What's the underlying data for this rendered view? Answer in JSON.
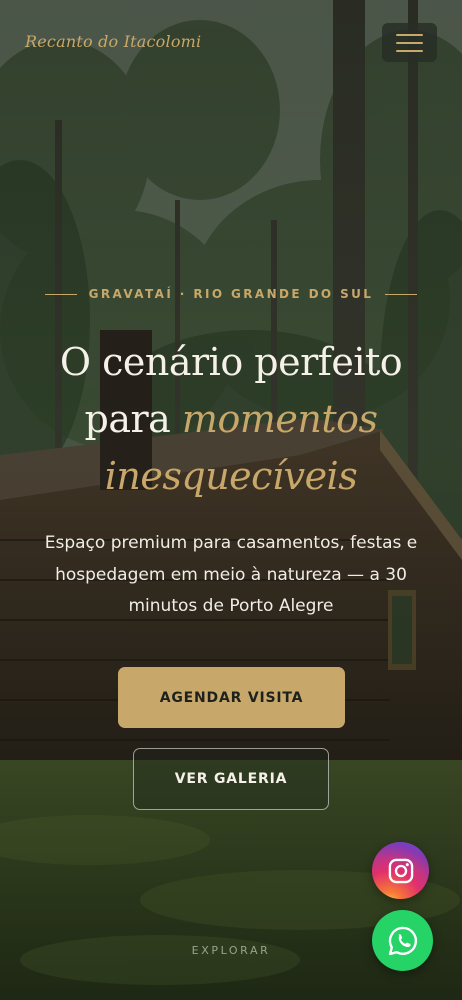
{
  "header": {
    "brand": "Recanto do Itacolomi",
    "menu_icon": "hamburger-icon"
  },
  "hero": {
    "kicker": "GRAVATAÍ · RIO GRANDE DO SUL",
    "headline_line1": "O cenário perfeito",
    "headline_line2_plain": "para",
    "headline_line2_accent": "momentos",
    "headline_line3_accent": "inesquecíveis",
    "subtitle": "Espaço premium para casamentos, festas e hospedagem em meio à natureza — a 30 minutos de Porto Alegre",
    "primary_cta": "AGENDAR VISITA",
    "secondary_cta": "VER GALERIA",
    "scroll_hint": "EXPLORAR"
  },
  "floating": {
    "instagram_icon": "instagram-icon",
    "whatsapp_icon": "whatsapp-icon"
  },
  "colors": {
    "accent": "#c8a86a",
    "text_light": "#f5f1e8",
    "whatsapp": "#25d366"
  }
}
